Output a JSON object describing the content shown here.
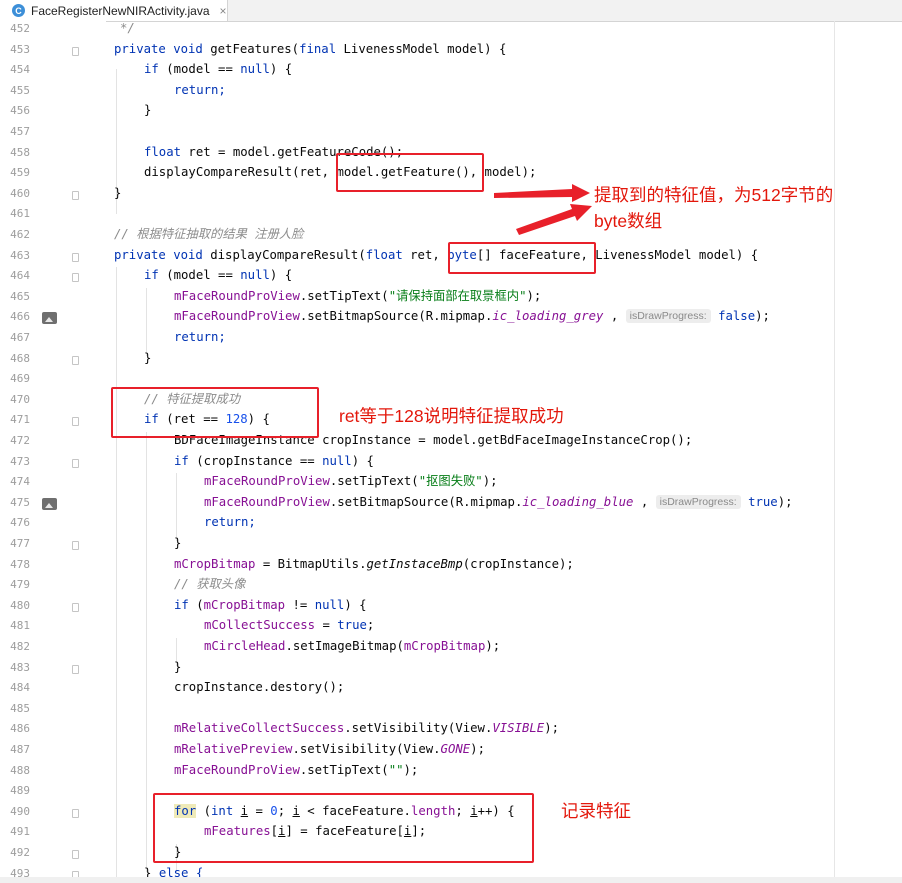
{
  "tab": {
    "icon": "C",
    "title": "FaceRegisterNewNIRActivity.java",
    "close": "×"
  },
  "gutter": {
    "line_numbers": [
      "452",
      "453",
      "454",
      "455",
      "456",
      "457",
      "458",
      "459",
      "460",
      "461",
      "462",
      "463",
      "464",
      "465",
      "466",
      "467",
      "468",
      "469",
      "470",
      "471",
      "472",
      "473",
      "474",
      "475",
      "476",
      "477",
      "478",
      "479",
      "480",
      "481",
      "482",
      "483",
      "484",
      "485",
      "486",
      "487",
      "488",
      "489",
      "490",
      "491",
      "492",
      "493"
    ],
    "image_icons_on_lines": [
      "466",
      "475"
    ]
  },
  "code": {
    "l452": "*/",
    "l453_a": "private void ",
    "l453_b": "getFeatures(",
    "l453_c": "final ",
    "l453_d": "LivenessModel model) {",
    "l454_a": "if ",
    "l454_b": "(model == ",
    "l454_c": "null",
    "l454_d": ") {",
    "l455": "return;",
    "l456": "}",
    "l458_a": "float ",
    "l458_b": "ret = model.getFeatureCode();",
    "l459": "displayCompareResult(ret, model.getFeature(), model);",
    "l460": "}",
    "l462": "// 根据特征抽取的结果 注册人脸",
    "l463_a": "private void ",
    "l463_b": "displayCompareResult(",
    "l463_c": "float ",
    "l463_d": "ret, ",
    "l463_e": "byte",
    "l463_f": "[] faceFeature, LivenessModel model) {",
    "l464_a": "if ",
    "l464_b": "(model == ",
    "l464_c": "null",
    "l464_d": ") {",
    "l465_a": "mFaceRoundProView",
    "l465_b": ".setTipText(",
    "l465_c": "\"请保持面部在取景框内\"",
    "l465_d": ");",
    "l466_a": "mFaceRoundProView",
    "l466_b": ".setBitmapSource(R.mipmap.",
    "l466_c": "ic_loading_grey",
    "l466_d": " , ",
    "l466_hint": "isDrawProgress:",
    "l466_e": " false",
    "l466_f": ");",
    "l467": "return;",
    "l468": "}",
    "l470": "// 特征提取成功",
    "l471_a": "if ",
    "l471_b": "(ret == ",
    "l471_c": "128",
    "l471_d": ") {",
    "l472": "BDFaceImageInstance cropInstance = model.getBdFaceImageInstanceCrop();",
    "l473_a": "if ",
    "l473_b": "(cropInstance == ",
    "l473_c": "null",
    "l473_d": ") {",
    "l474_a": "mFaceRoundProView",
    "l474_b": ".setTipText(",
    "l474_c": "\"抠图失败\"",
    "l474_d": ");",
    "l475_a": "mFaceRoundProView",
    "l475_b": ".setBitmapSource(R.mipmap.",
    "l475_c": "ic_loading_blue",
    "l475_d": " , ",
    "l475_hint": "isDrawProgress:",
    "l475_e": " true",
    "l475_f": ");",
    "l476": "return;",
    "l477": "}",
    "l478_a": "mCropBitmap",
    "l478_b": " = BitmapUtils.",
    "l478_c": "getInstaceBmp",
    "l478_d": "(cropInstance);",
    "l479": "// 获取头像",
    "l480_a": "if ",
    "l480_b": "(",
    "l480_c": "mCropBitmap",
    "l480_d": " != ",
    "l480_e": "null",
    "l480_f": ") {",
    "l481_a": "mCollectSuccess",
    "l481_b": " = ",
    "l481_c": "true",
    "l481_d": ";",
    "l482_a": "mCircleHead",
    "l482_b": ".setImageBitmap(",
    "l482_c": "mCropBitmap",
    "l482_d": ");",
    "l483": "}",
    "l484": "cropInstance.destory();",
    "l486_a": "mRelativeCollectSuccess",
    "l486_b": ".setVisibility(View.",
    "l486_c": "VISIBLE",
    "l486_d": ");",
    "l487_a": "mRelativePreview",
    "l487_b": ".setVisibility(View.",
    "l487_c": "GONE",
    "l487_d": ");",
    "l488_a": "mFaceRoundProView",
    "l488_b": ".setTipText(",
    "l488_c": "\"\"",
    "l488_d": ");",
    "l490_a": "for",
    "l490_b": " (",
    "l490_c": "int ",
    "l490_d": "i",
    "l490_e": " = ",
    "l490_f": "0",
    "l490_g": "; ",
    "l490_h": "i",
    "l490_i": " < faceFeature.",
    "l490_j": "length",
    "l490_k": "; ",
    "l490_l": "i",
    "l490_m": "++) {",
    "l491_a": "mFeatures",
    "l491_b": "[",
    "l491_c": "i",
    "l491_d": "] = faceFeature[",
    "l491_e": "i",
    "l491_f": "];",
    "l492": "}",
    "l493_a": "} ",
    "l493_b": "else {"
  },
  "annotations": {
    "feature_line1": "提取到的特征值，为512字节的",
    "feature_line2": "byte数组",
    "ret_check": "ret等于128说明特征提取成功",
    "record": "记录特征"
  },
  "colors": {
    "keyword": "#0033b3",
    "field": "#871094",
    "string": "#067d17",
    "number": "#1750eb",
    "comment": "#8c8c8c",
    "annotation_red": "#e8202a"
  }
}
